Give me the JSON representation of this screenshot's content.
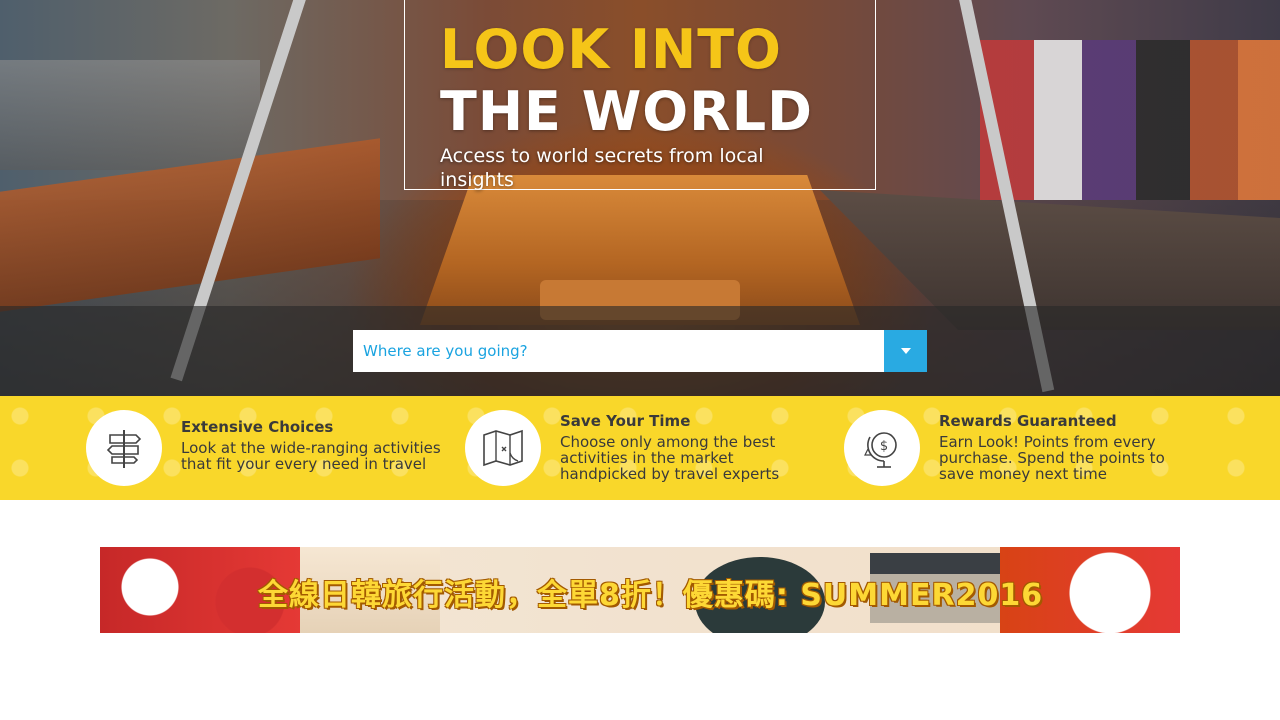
{
  "hero": {
    "headline_line1": "LOOK INTO",
    "headline_line2": "THE WORLD",
    "subheadline": "Access to world secrets from local insights",
    "colors": {
      "headline_accent": "#f5c518",
      "headline_secondary": "#ffffff"
    }
  },
  "search": {
    "placeholder": "Where are you going?",
    "dropdown_icon": "chevron-down-icon",
    "colors": {
      "button": "#29aae2",
      "placeholder": "#1aa3e0"
    }
  },
  "features": {
    "background_color": "#f9d72a",
    "items": [
      {
        "icon": "signpost-icon",
        "title": "Extensive Choices",
        "description": "Look at the wide-ranging activities that fit your every need in travel"
      },
      {
        "icon": "map-icon",
        "title": "Save Your Time",
        "description": "Choose only among the best activities in the market handpicked by travel experts"
      },
      {
        "icon": "globe-dollar-icon",
        "title": "Rewards Guaranteed",
        "description": "Earn Look! Points from every purchase. Spend the points to save money next time"
      }
    ]
  },
  "banner": {
    "promo_text": "全線日韓旅行活動，全單8折！優惠碼: SUMMER2016"
  }
}
